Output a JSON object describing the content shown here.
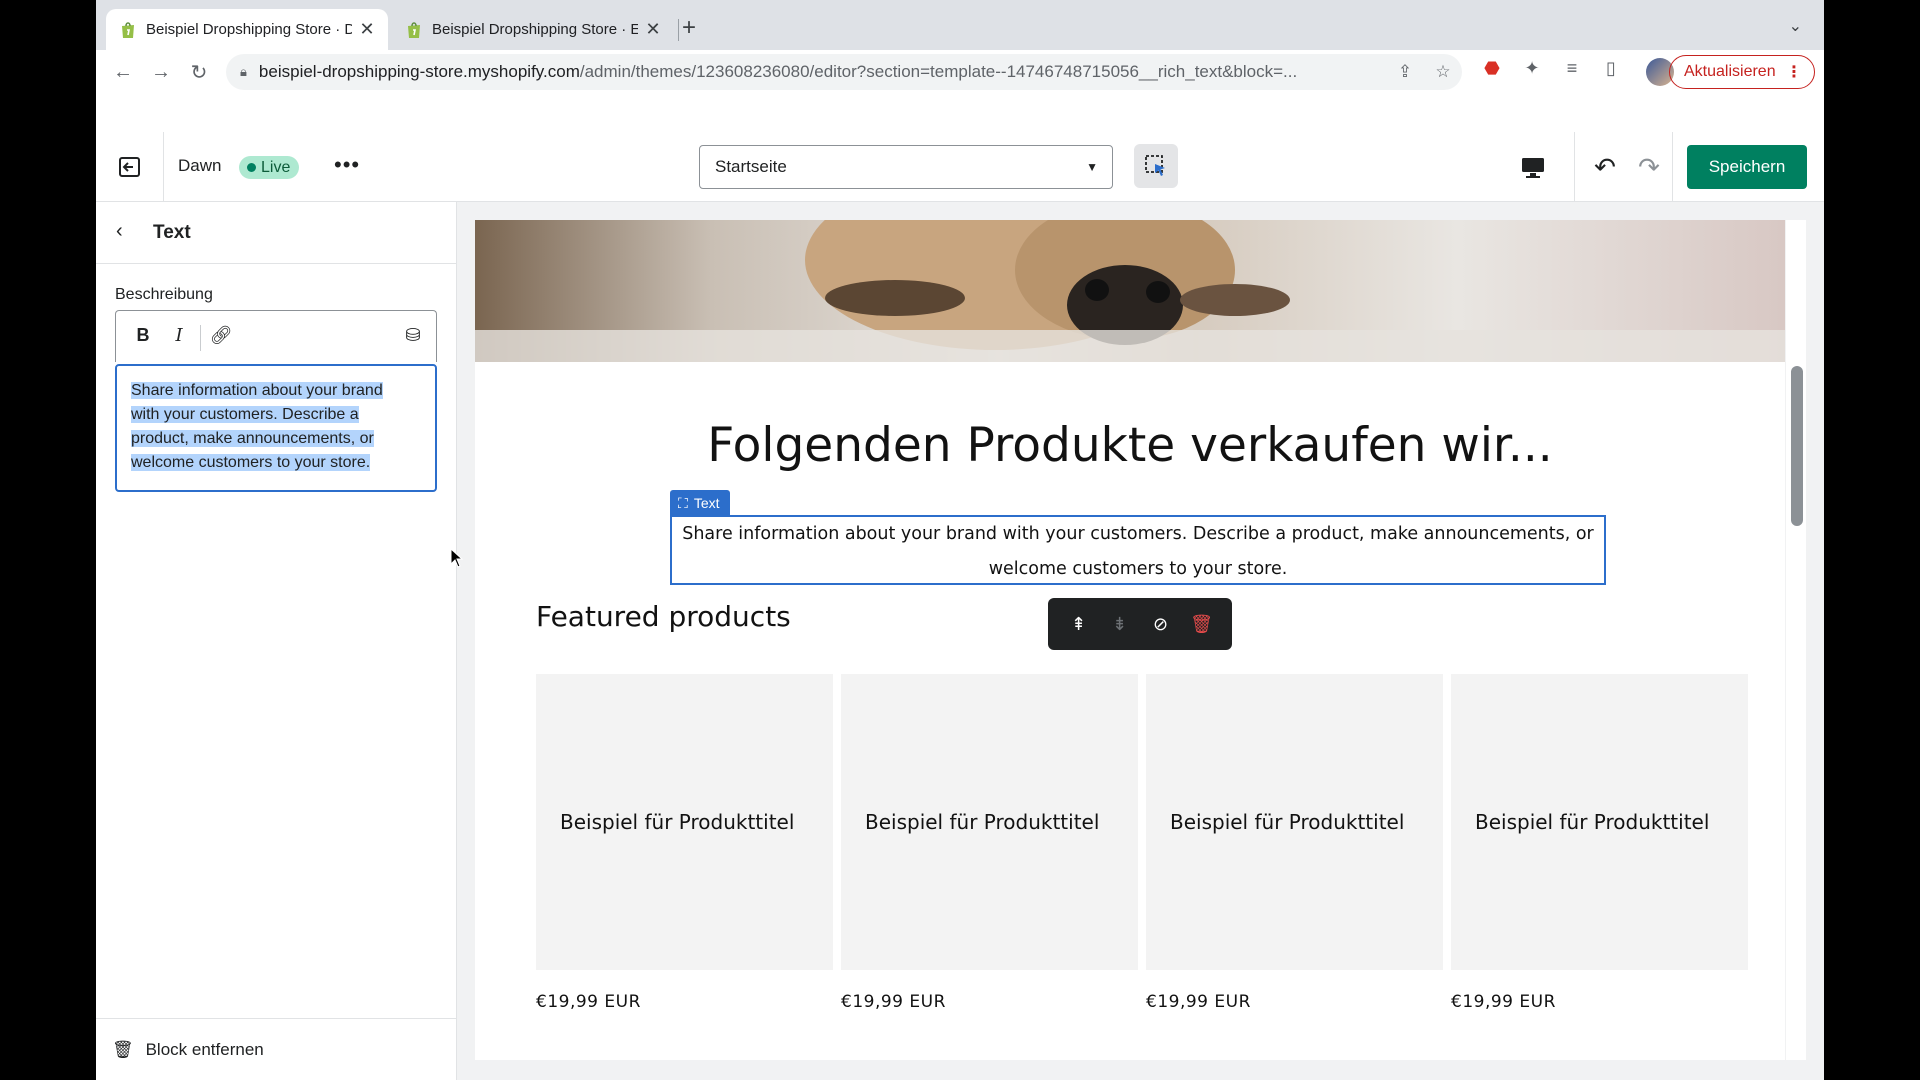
{
  "browser": {
    "tabs": [
      {
        "title": "Beispiel Dropshipping Store · D"
      },
      {
        "title": "Beispiel Dropshipping Store · E"
      }
    ],
    "address": {
      "host": "beispiel-dropshipping-store.myshopify.com",
      "path": "/admin/themes/123608236080/editor?section=template--14746748715056__rich_text&block=..."
    },
    "update_label": "Aktualisieren"
  },
  "editor": {
    "theme_name": "Dawn",
    "live_label": "Live",
    "page_select": "Startseite",
    "save_label": "Speichern"
  },
  "sidebar": {
    "title": "Text",
    "field_label": "Beschreibung",
    "rte_text": "Share information about your brand with your customers. Describe a product, make announcements, or welcome customers to your store.",
    "rte_lines": [
      "Share information about your brand",
      "with your customers. Describe a",
      "product, make announcements, or",
      "welcome customers to your store."
    ],
    "remove_label": "Block entfernen"
  },
  "preview": {
    "headline": "Folgenden Produkte verkaufen wir...",
    "text_tag": "Text",
    "text_lines": [
      "Share information about your brand with your customers. Describe a product, make announcements, or",
      "welcome customers to your store."
    ],
    "featured_title": "Featured products",
    "products": [
      {
        "title": "Beispiel für Produkttitel",
        "price": "€19,99 EUR"
      },
      {
        "title": "Beispiel für Produkttitel",
        "price": "€19,99 EUR"
      },
      {
        "title": "Beispiel für Produkttitel",
        "price": "€19,99 EUR"
      },
      {
        "title": "Beispiel für Produkttitel",
        "price": "€19,99 EUR"
      }
    ]
  },
  "colors": {
    "primary": "#008060",
    "selection": "#2c6ecb",
    "live_badge": "#aee9d1",
    "update_red": "#c5221f"
  }
}
